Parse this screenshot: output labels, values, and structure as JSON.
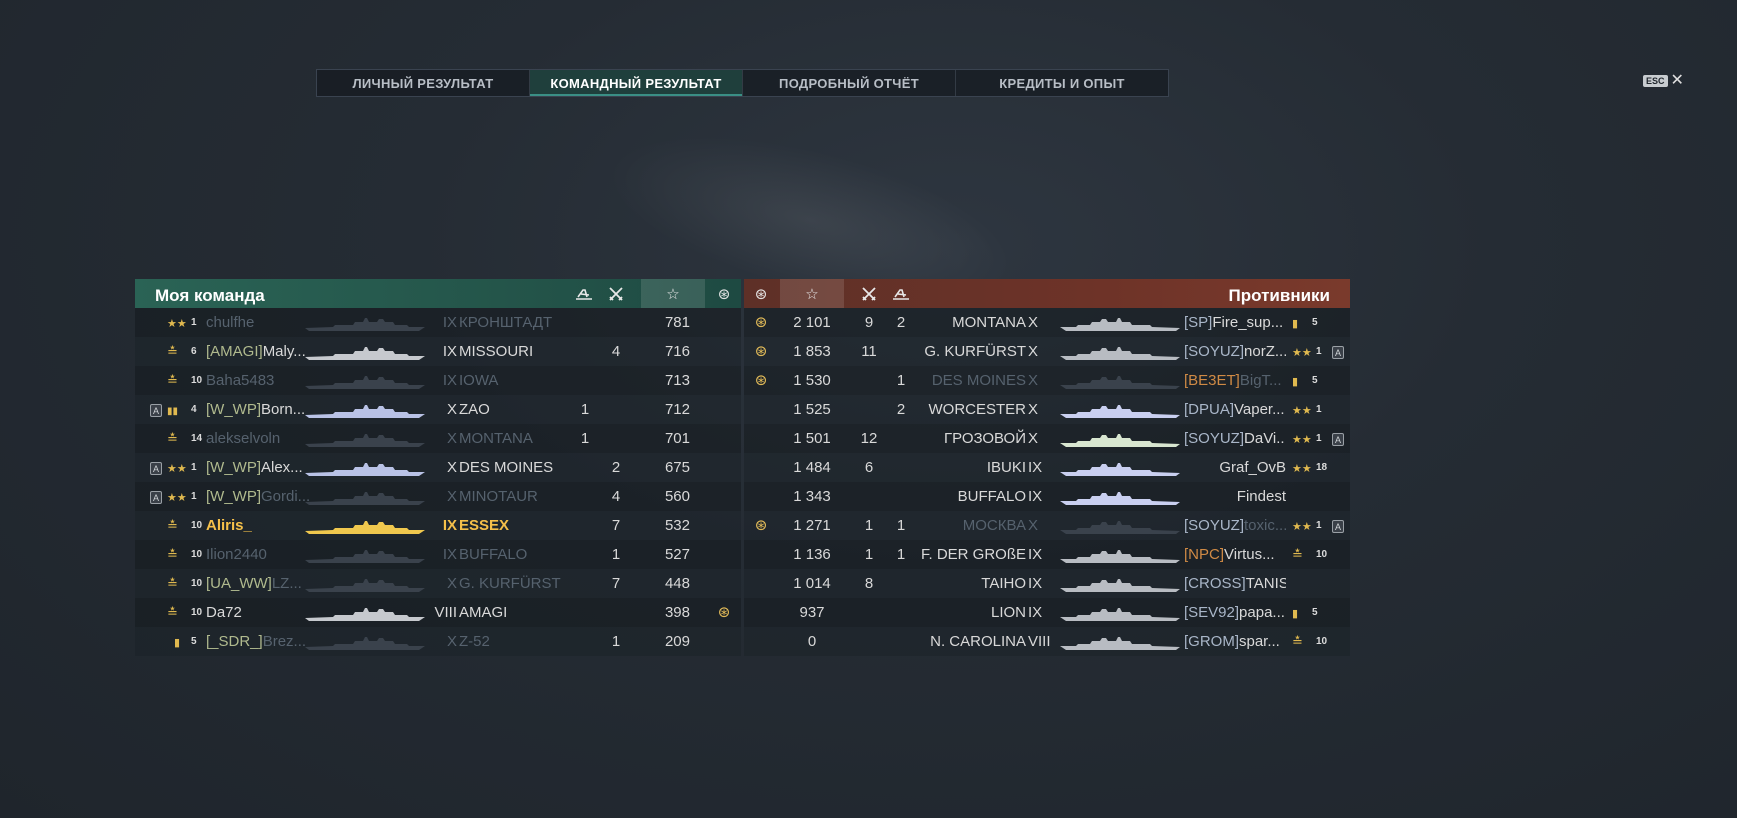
{
  "tabs": [
    {
      "label": "ЛИЧНЫЙ РЕЗУЛЬТАТ",
      "active": false
    },
    {
      "label": "КОМАНДНЫЙ РЕЗУЛЬТАТ",
      "active": true
    },
    {
      "label": "ПОДРОБНЫЙ ОТЧЁТ",
      "active": false
    },
    {
      "label": "КРЕДИТЫ И ОПЫТ",
      "active": false
    }
  ],
  "esc_label": "ESC",
  "my_team": {
    "title": "Моя команда",
    "rows": [
      {
        "rank_icon": "stars",
        "rank": "1",
        "badge": "",
        "clan": "",
        "name": "chulfhe",
        "tier": "IX",
        "ship": "КРОНШТАДТ",
        "kills": "",
        "planes": "",
        "xp": "781",
        "medal": false,
        "dim": true,
        "hl": false,
        "color": "#3a424c"
      },
      {
        "rank_icon": "ribbon",
        "rank": "6",
        "badge": "",
        "clan": "[AMAGI]",
        "name": "Maly...",
        "tier": "IX",
        "ship": "MISSOURI",
        "kills": "4",
        "planes": "",
        "xp": "716",
        "medal": false,
        "dim": false,
        "hl": false,
        "color": "#c6c9ce"
      },
      {
        "rank_icon": "ribbon",
        "rank": "10",
        "badge": "",
        "clan": "",
        "name": "Baha5483",
        "tier": "IX",
        "ship": "IOWA",
        "kills": "",
        "planes": "",
        "xp": "713",
        "medal": false,
        "dim": true,
        "hl": false,
        "color": "#3a424c"
      },
      {
        "rank_icon": "bars",
        "rank": "4",
        "badge": "A",
        "clan": "[W_WP]",
        "name": "Born...",
        "tier": "X",
        "ship": "ZAO",
        "kills": "",
        "planes": "1",
        "xp": "712",
        "medal": false,
        "dim": false,
        "hl": false,
        "color": "#b9c2e6"
      },
      {
        "rank_icon": "ribbon",
        "rank": "14",
        "badge": "",
        "clan": "",
        "name": "alekselvoln",
        "tier": "X",
        "ship": "MONTANA",
        "kills": "",
        "planes": "1",
        "xp": "701",
        "medal": false,
        "dim": true,
        "hl": false,
        "color": "#3a424c"
      },
      {
        "rank_icon": "stars",
        "rank": "1",
        "badge": "A",
        "clan": "[W_WP]",
        "name": "Alex...",
        "tier": "X",
        "ship": "DES MOINES",
        "kills": "2",
        "planes": "",
        "xp": "675",
        "medal": false,
        "dim": false,
        "hl": false,
        "color": "#b9c2e6"
      },
      {
        "rank_icon": "stars",
        "rank": "1",
        "badge": "A",
        "clan": "[W_WP]",
        "name": "Gordi...",
        "tier": "X",
        "ship": "MINOTAUR",
        "kills": "4",
        "planes": "",
        "xp": "560",
        "medal": false,
        "dim": true,
        "hl": false,
        "color": "#3a424c"
      },
      {
        "rank_icon": "ribbon",
        "rank": "10",
        "badge": "",
        "clan": "",
        "name": "Aliris_",
        "tier": "IX",
        "ship": "ESSEX",
        "kills": "7",
        "planes": "",
        "xp": "532",
        "medal": false,
        "dim": false,
        "hl": true,
        "color": "#f0c84e"
      },
      {
        "rank_icon": "ribbon",
        "rank": "10",
        "badge": "",
        "clan": "",
        "name": "Ilion2440",
        "tier": "IX",
        "ship": "BUFFALO",
        "kills": "1",
        "planes": "",
        "xp": "527",
        "medal": false,
        "dim": true,
        "hl": false,
        "color": "#3a424c"
      },
      {
        "rank_icon": "ribbon",
        "rank": "10",
        "badge": "",
        "clan": "[UA_WW]",
        "name": "LZ...",
        "tier": "X",
        "ship": "G. KURFÜRST",
        "kills": "7",
        "planes": "",
        "xp": "448",
        "medal": false,
        "dim": true,
        "hl": false,
        "color": "#3a424c"
      },
      {
        "rank_icon": "ribbon",
        "rank": "10",
        "badge": "",
        "clan": "",
        "name": "Da72",
        "tier": "VIII",
        "ship": "AMAGI",
        "kills": "",
        "planes": "",
        "xp": "398",
        "medal": true,
        "dim": false,
        "hl": false,
        "color": "#c6c9ce"
      },
      {
        "rank_icon": "bar",
        "rank": "5",
        "badge": "",
        "clan": "[_SDR_]",
        "name": "Brez...",
        "tier": "X",
        "ship": "Z-52",
        "kills": "1",
        "planes": "",
        "xp": "209",
        "medal": false,
        "dim": true,
        "hl": false,
        "color": "#3a424c"
      }
    ]
  },
  "enemy_team": {
    "title": "Противники",
    "rows": [
      {
        "medal": true,
        "xp": "2 101",
        "kills": "9",
        "planes": "2",
        "ship": "MONTANA",
        "tier": "X",
        "clan": "[SP]",
        "name": "Fire_sup...",
        "rank_icon": "bar",
        "rank": "5",
        "badge": "",
        "dim": false,
        "clan_orange": false,
        "color": "#b8bcc2"
      },
      {
        "medal": true,
        "xp": "1 853",
        "kills": "11",
        "planes": "",
        "ship": "G. KURFÜRST",
        "tier": "X",
        "clan": "[SOYUZ]",
        "name": "norZ...",
        "rank_icon": "stars",
        "rank": "1",
        "badge": "A",
        "dim": false,
        "clan_orange": false,
        "color": "#b8bcc2"
      },
      {
        "medal": true,
        "xp": "1 530",
        "kills": "",
        "planes": "1",
        "ship": "DES MOINES",
        "tier": "X",
        "clan": "[BE3ET]",
        "name": "BigT...",
        "rank_icon": "bar",
        "rank": "5",
        "badge": "",
        "dim": true,
        "clan_orange": true,
        "color": "#3a424c"
      },
      {
        "medal": false,
        "xp": "1 525",
        "kills": "",
        "planes": "2",
        "ship": "WORCESTER",
        "tier": "X",
        "clan": "[DPUA]",
        "name": "Vaper...",
        "rank_icon": "stars",
        "rank": "1",
        "badge": "",
        "dim": false,
        "clan_orange": false,
        "color": "#c9cff0"
      },
      {
        "medal": false,
        "xp": "1 501",
        "kills": "12",
        "planes": "",
        "ship": "ГРОЗОВОЙ",
        "tier": "X",
        "clan": "[SOYUZ]",
        "name": "DaVi...",
        "rank_icon": "stars",
        "rank": "1",
        "badge": "A",
        "dim": false,
        "clan_orange": false,
        "color": "#d8e6d0"
      },
      {
        "medal": false,
        "xp": "1 484",
        "kills": "6",
        "planes": "",
        "ship": "IBUKI",
        "tier": "IX",
        "clan": "",
        "name": "Graf_OvB",
        "rank_icon": "stars",
        "rank": "18",
        "badge": "",
        "dim": false,
        "clan_orange": false,
        "color": "#c9cff0"
      },
      {
        "medal": false,
        "xp": "1 343",
        "kills": "",
        "planes": "",
        "ship": "BUFFALO",
        "tier": "IX",
        "clan": "",
        "name": "Findest",
        "rank_icon": "",
        "rank": "",
        "badge": "",
        "dim": false,
        "clan_orange": false,
        "color": "#c9cff0"
      },
      {
        "medal": true,
        "xp": "1 271",
        "kills": "1",
        "planes": "1",
        "ship": "МОСКВА",
        "tier": "X",
        "clan": "[SOYUZ]",
        "name": "toxic...",
        "rank_icon": "stars",
        "rank": "1",
        "badge": "A",
        "dim": true,
        "clan_orange": false,
        "color": "#3a424c"
      },
      {
        "medal": false,
        "xp": "1 136",
        "kills": "1",
        "planes": "1",
        "ship": "F. DER GROßE",
        "tier": "IX",
        "clan": "[NPC]",
        "name": "Virtus...",
        "rank_icon": "ribbon",
        "rank": "10",
        "badge": "",
        "dim": false,
        "clan_orange": true,
        "color": "#b8bcc2"
      },
      {
        "medal": false,
        "xp": "1 014",
        "kills": "8",
        "planes": "",
        "ship": "TAIHO",
        "tier": "IX",
        "clan": "[CROSS]",
        "name": "TANIST_z...",
        "rank_icon": "",
        "rank": "",
        "badge": "",
        "dim": false,
        "clan_orange": false,
        "color": "#b8bcc2"
      },
      {
        "medal": false,
        "xp": "937",
        "kills": "",
        "planes": "",
        "ship": "LION",
        "tier": "IX",
        "clan": "[SEV92]",
        "name": "papa...",
        "rank_icon": "bar",
        "rank": "5",
        "badge": "",
        "dim": false,
        "clan_orange": false,
        "color": "#b8bcc2"
      },
      {
        "medal": false,
        "xp": "0",
        "kills": "",
        "planes": "",
        "ship": "N. CAROLINA",
        "tier": "VIII",
        "clan": "[GROM]",
        "name": "spar...",
        "rank_icon": "ribbon",
        "rank": "10",
        "badge": "",
        "dim": false,
        "clan_orange": false,
        "color": "#b8bcc2"
      }
    ]
  }
}
